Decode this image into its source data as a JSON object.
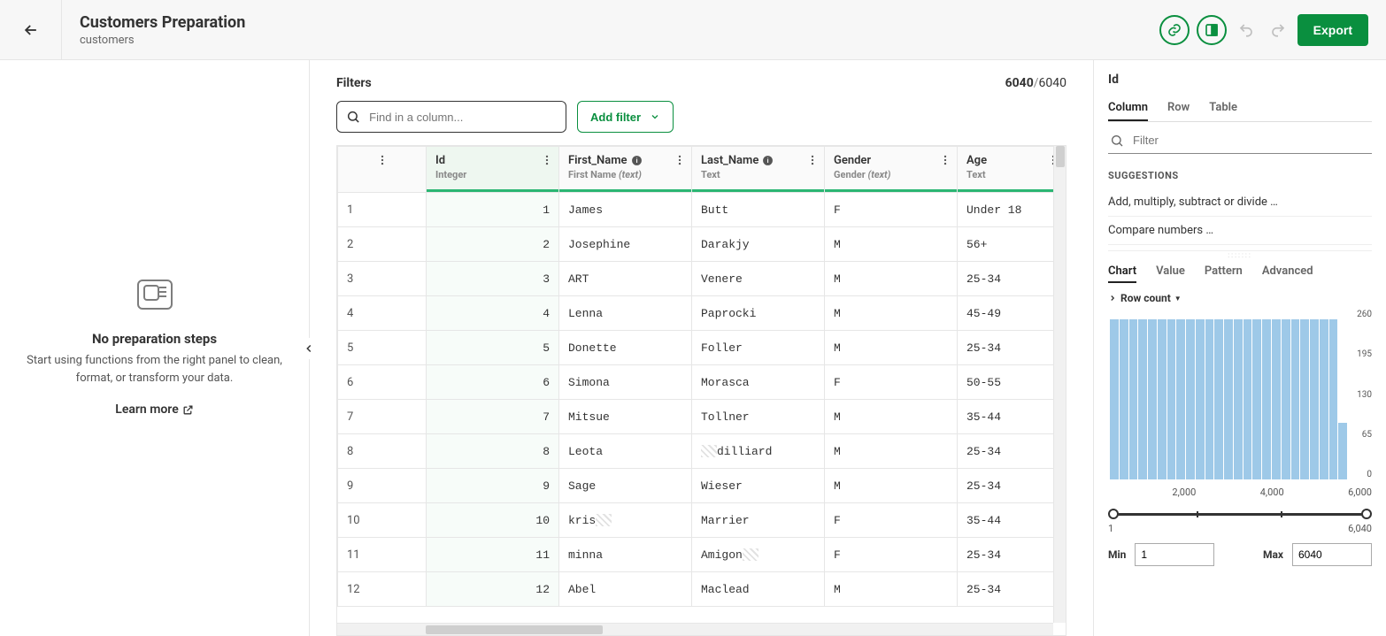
{
  "header": {
    "title": "Customers Preparation",
    "subtitle": "customers",
    "export_label": "Export"
  },
  "filters": {
    "label": "Filters",
    "search_placeholder": "Find in a column...",
    "add_filter_label": "Add filter",
    "row_filtered": "6040",
    "row_total": "6040"
  },
  "columns": [
    {
      "name": "Id",
      "type": "Integer",
      "type_hint": "",
      "info": false
    },
    {
      "name": "First_Name",
      "type": "First Name",
      "type_hint": "(text)",
      "info": true
    },
    {
      "name": "Last_Name",
      "type": "Text",
      "type_hint": "",
      "info": true
    },
    {
      "name": "Gender",
      "type": "Gender",
      "type_hint": "(text)",
      "info": false
    },
    {
      "name": "Age",
      "type": "Text",
      "type_hint": "",
      "info": false
    }
  ],
  "rows": [
    {
      "n": "1",
      "id": "1",
      "first": "James",
      "last": "Butt",
      "gender": "F",
      "age": "Under 18"
    },
    {
      "n": "2",
      "id": "2",
      "first": "Josephine",
      "last": "Darakjy",
      "gender": "M",
      "age": "56+"
    },
    {
      "n": "3",
      "id": "3",
      "first": "ART",
      "last": "Venere",
      "gender": "M",
      "age": "25-34"
    },
    {
      "n": "4",
      "id": "4",
      "first": "Lenna",
      "last": "Paprocki",
      "gender": "M",
      "age": "45-49"
    },
    {
      "n": "5",
      "id": "5",
      "first": "Donette",
      "last": "Foller",
      "gender": "M",
      "age": "25-34"
    },
    {
      "n": "6",
      "id": "6",
      "first": "Simona",
      "last": "Morasca",
      "gender": "F",
      "age": "50-55"
    },
    {
      "n": "7",
      "id": "7",
      "first": "Mitsue",
      "last": "Tollner",
      "gender": "M",
      "age": "35-44"
    },
    {
      "n": "8",
      "id": "8",
      "first": "Leota",
      "last": "dilliard",
      "last_hatched_pre": true,
      "gender": "M",
      "age": "25-34"
    },
    {
      "n": "9",
      "id": "9",
      "first": "Sage",
      "last": "Wieser",
      "gender": "M",
      "age": "25-34"
    },
    {
      "n": "10",
      "id": "10",
      "first": "kris",
      "first_hatched_post": true,
      "last": "Marrier",
      "gender": "F",
      "age": "35-44"
    },
    {
      "n": "11",
      "id": "11",
      "first": "minna",
      "last": "Amigon",
      "last_hatched_post": true,
      "gender": "F",
      "age": "25-34"
    },
    {
      "n": "12",
      "id": "12",
      "first": "Abel",
      "last": "Maclead",
      "gender": "M",
      "age": "25-34"
    }
  ],
  "left": {
    "empty_title": "No preparation steps",
    "empty_desc": "Start using functions from the right panel to clean, format, or transform your data.",
    "learn_more": "Learn more"
  },
  "right": {
    "column_title": "Id",
    "tabs": [
      "Column",
      "Row",
      "Table"
    ],
    "active_tab": 0,
    "filter_placeholder": "Filter",
    "section_label": "SUGGESTIONS",
    "suggestions": [
      "Add, multiply, subtract or divide …",
      "Compare numbers …"
    ],
    "subtabs": [
      "Chart",
      "Value",
      "Pattern",
      "Advanced"
    ],
    "active_subtab": 0,
    "rowcount_label": "Row count",
    "yticks": [
      "260",
      "195",
      "130",
      "65",
      "0"
    ],
    "xticks": [
      "",
      "2,000",
      "4,000",
      "6,000"
    ],
    "slider_min_label": "1",
    "slider_max_label": "6,040",
    "min_label": "Min",
    "max_label": "Max",
    "min_value": "1",
    "max_value": "6040"
  },
  "chart_data": {
    "type": "bar",
    "title": "Row count",
    "xlabel": "Id",
    "ylabel": "Row count",
    "ylim": [
      0,
      260
    ],
    "xlim": [
      1,
      6040
    ],
    "bins": 25,
    "values": [
      248,
      248,
      248,
      248,
      248,
      248,
      248,
      248,
      248,
      248,
      248,
      248,
      248,
      248,
      248,
      248,
      248,
      248,
      248,
      248,
      248,
      248,
      248,
      248,
      88
    ]
  }
}
